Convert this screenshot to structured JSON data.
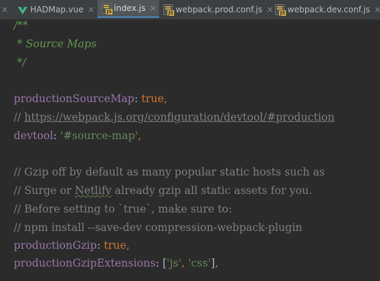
{
  "tabs": [
    {
      "name": "leading-close",
      "close": "×"
    },
    {
      "label": "HADMap.vue",
      "icon": "vue-icon",
      "close": "×"
    },
    {
      "label": "index.js",
      "icon": "js-icon",
      "close": "×",
      "active": true
    },
    {
      "label": "webpack.prod.conf.js",
      "icon": "js-icon",
      "close": "×"
    },
    {
      "label": "webpack.dev.conf.js",
      "icon": "js-icon",
      "close": "×"
    }
  ],
  "js_badge": "JS",
  "code": {
    "doc_open": "/**",
    "doc_middle": " * Source Maps",
    "doc_close": " */",
    "production_source_map_key": "productionSourceMap",
    "colon": ":",
    "true_value": "true",
    "comma": ",",
    "comment_prefix": "// ",
    "url": "https://webpack.js.org/configuration/devtool/#production",
    "devtool_key": "devtool",
    "devtool_value": "'#source-map'",
    "gzip_comment_1": "// Gzip off by default as many popular static hosts such as",
    "gzip_comment_2a": "// Surge or ",
    "netlify": "Netlify",
    "gzip_comment_2b": " already gzip all static assets for you.",
    "gzip_comment_3": "// Before setting to `true`, make sure to:",
    "gzip_comment_4": "// npm install --save-dev compression-webpack-plugin",
    "production_gzip_key": "productionGzip",
    "production_gzip_ext_key": "productionGzipExtensions",
    "bracket_open": "[",
    "ext_js": "'js'",
    "ext_css": "'css'",
    "bracket_close": "]"
  },
  "colors": {
    "background": "#2b2b2b",
    "doc_comment": "#629755",
    "line_comment": "#808080",
    "property_key": "#9876aa",
    "keyword": "#cc7832",
    "string": "#6a8759",
    "tab_active_underline": "#4a88c7"
  }
}
